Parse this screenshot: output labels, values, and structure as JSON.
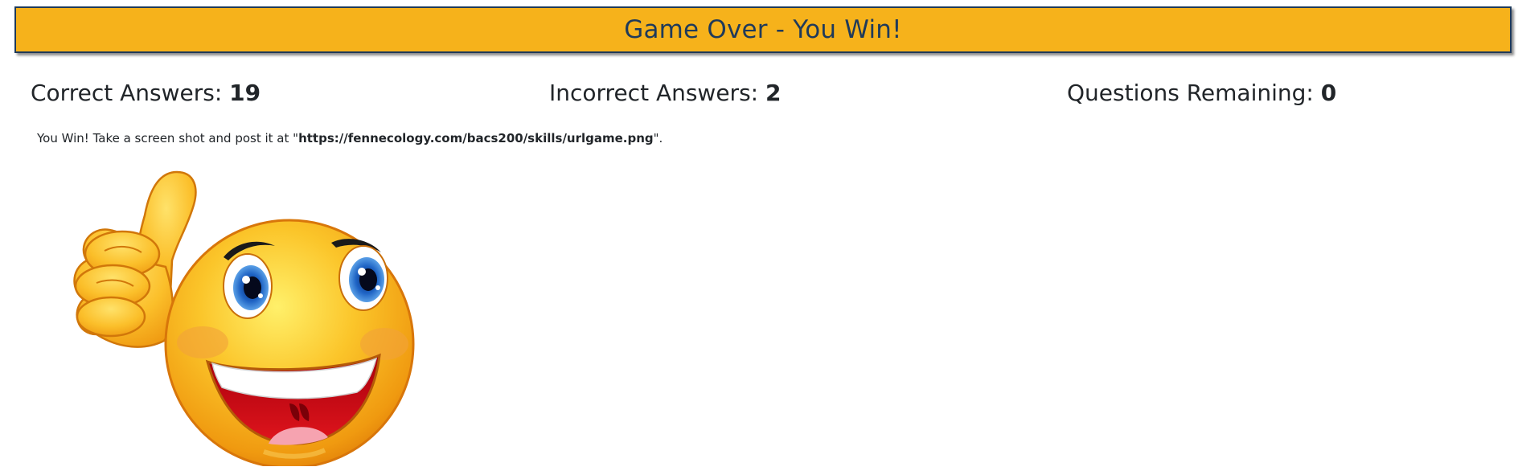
{
  "header": {
    "title": "Game Over - You Win!"
  },
  "stats": {
    "correct_label": "Correct Answers: ",
    "correct_value": "19",
    "incorrect_label": "Incorrect Answers: ",
    "incorrect_value": "2",
    "remaining_label": "Questions Remaining: ",
    "remaining_value": "0"
  },
  "message": {
    "prefix": "You Win! Take a screen shot and post it at \"",
    "url": "https://fennecology.com/bacs200/skills/urlgame.png",
    "suffix": "\"."
  },
  "image": {
    "name": "thumbs-up-smiley",
    "colors": {
      "banner": "#f6b21b",
      "banner_border": "#1f3a5a",
      "face": "#f7b518",
      "mouth": "#d8121b",
      "eye": "#1e63c4"
    }
  }
}
